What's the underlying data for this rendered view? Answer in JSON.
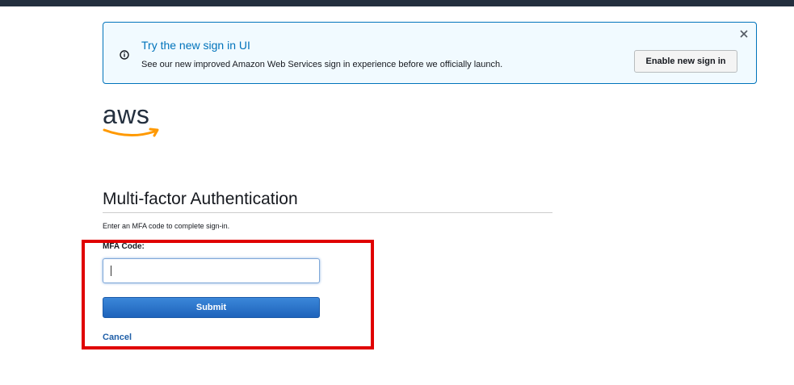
{
  "banner": {
    "title": "Try the new sign in UI",
    "text": "See our new improved Amazon Web Services sign in experience before we officially launch.",
    "button_label": "Enable new sign in",
    "info_icon": "info-icon",
    "close_icon": "close-icon"
  },
  "logo": {
    "text": "aws"
  },
  "main": {
    "title": "Multi-factor Authentication",
    "instruction": "Enter an MFA code to complete sign-in.",
    "field_label": "MFA Code:",
    "field_value": "",
    "submit_label": "Submit",
    "cancel_label": "Cancel"
  },
  "colors": {
    "top_bar": "#232f3e",
    "banner_border": "#0073bb",
    "banner_bg": "#f1faff",
    "link": "#1f5fa8",
    "submit_bg": "#1e63bb",
    "aws_orange": "#ff9900",
    "highlight": "#e00000"
  }
}
